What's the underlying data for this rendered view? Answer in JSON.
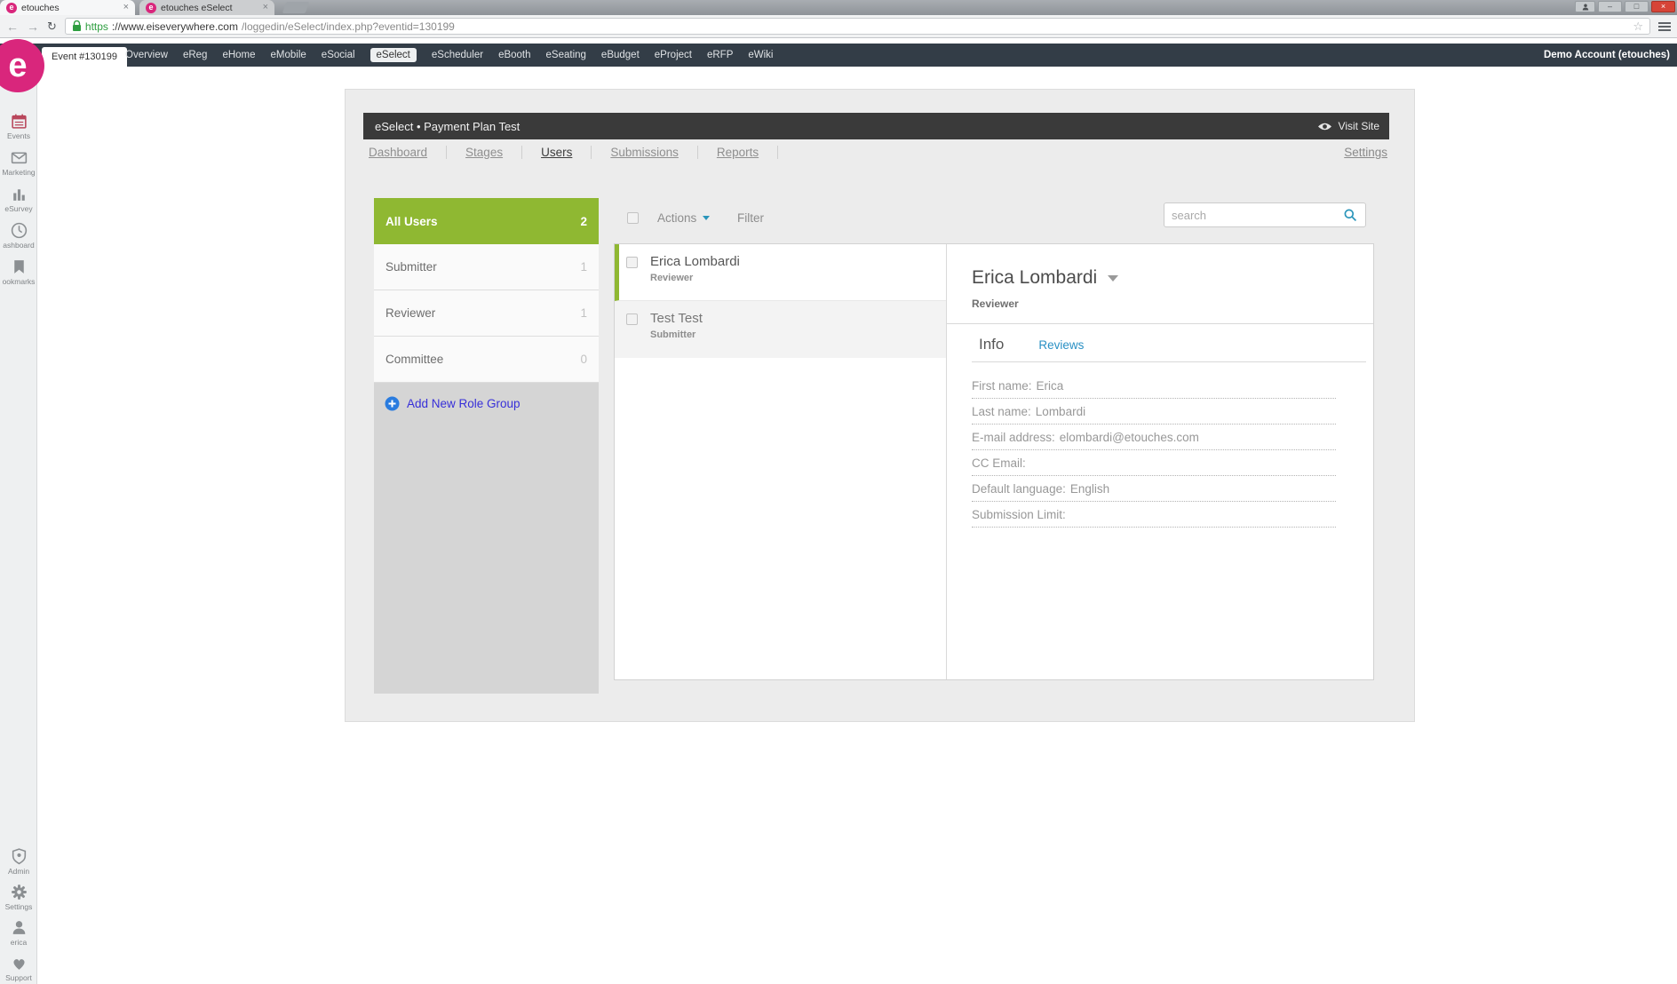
{
  "browser": {
    "tabs": [
      {
        "label": "etouches"
      },
      {
        "label": "etouches eSelect"
      }
    ],
    "url": {
      "scheme": "https",
      "domain": "://www.eiseverywhere.com",
      "path": "/loggedin/eSelect/index.php?eventid=130199"
    },
    "window": {
      "minimize": "–",
      "maximize": "□",
      "close": "×"
    }
  },
  "topnav": {
    "event_tab": "Event #130199",
    "items": [
      "Overview",
      "eReg",
      "eHome",
      "eMobile",
      "eSocial",
      "eSelect",
      "eScheduler",
      "eBooth",
      "eSeating",
      "eBudget",
      "eProject",
      "eRFP",
      "eWiki"
    ],
    "account": "Demo Account (etouches)"
  },
  "sidebar": {
    "logo_letter": "e",
    "top_items": [
      {
        "label": "Events"
      },
      {
        "label": "Marketing"
      },
      {
        "label": "eSurvey"
      },
      {
        "label": "ashboard"
      },
      {
        "label": "ookmarks"
      }
    ],
    "bottom_items": [
      {
        "label": "Admin"
      },
      {
        "label": "Settings"
      },
      {
        "label": "erica"
      },
      {
        "label": "Support"
      }
    ]
  },
  "module": {
    "title": "eSelect • Payment Plan Test",
    "visit_site": "Visit Site",
    "tabs": [
      "Dashboard",
      "Stages",
      "Users",
      "Submissions",
      "Reports"
    ],
    "settings": "Settings"
  },
  "roles": {
    "groups": [
      {
        "name": "All Users",
        "count": "2"
      },
      {
        "name": "Submitter",
        "count": "1"
      },
      {
        "name": "Reviewer",
        "count": "1"
      },
      {
        "name": "Committee",
        "count": "0"
      }
    ],
    "add_link": "Add New Role Group"
  },
  "list": {
    "actions": "Actions",
    "filter": "Filter",
    "search_placeholder": "search",
    "users": [
      {
        "name": "Erica Lombardi",
        "role": "Reviewer"
      },
      {
        "name": "Test Test",
        "role": "Submitter"
      }
    ]
  },
  "detail": {
    "name": "Erica Lombardi",
    "role": "Reviewer",
    "tabs": {
      "info": "Info",
      "reviews": "Reviews"
    },
    "fields": [
      {
        "label": "First name:",
        "value": "Erica"
      },
      {
        "label": "Last name:",
        "value": "Lombardi"
      },
      {
        "label": "E-mail address:",
        "value": "elombardi@etouches.com"
      },
      {
        "label": "CC Email:",
        "value": ""
      },
      {
        "label": "Default language:",
        "value": "English"
      },
      {
        "label": "Submission Limit:",
        "value": ""
      }
    ]
  },
  "colors": {
    "brand_pink": "#d9267c",
    "green": "#8fb832",
    "teal": "#2a95ba",
    "link_blue": "#372fd8",
    "plus_blue": "#2a7cdf",
    "topnav_bg": "#333d47",
    "module_header_bg": "#3a3a3a",
    "https_green": "#2e9e40",
    "close_red": "#d64437"
  }
}
